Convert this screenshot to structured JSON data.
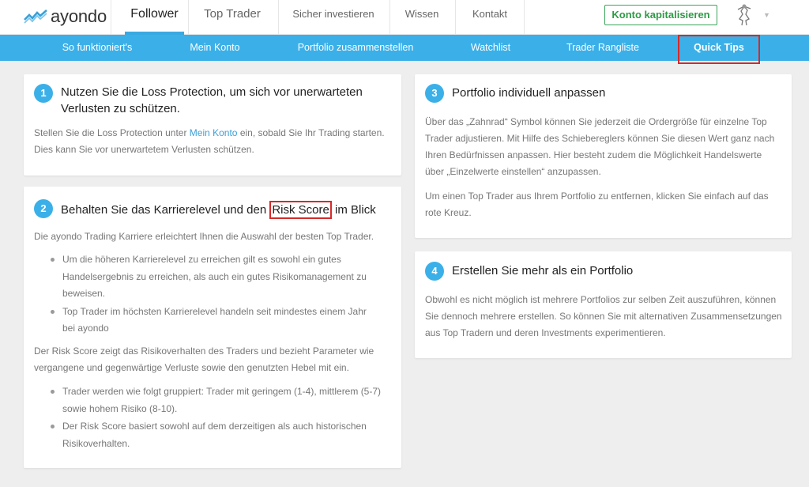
{
  "header": {
    "logo_text": "ayondo",
    "nav": [
      "Follower",
      "Top Trader",
      "Sicher investieren",
      "Wissen",
      "Kontakt"
    ],
    "cta_label": "Konto kapitalisieren"
  },
  "subnav": [
    "So funktioniert's",
    "Mein Konto",
    "Portfolio zusammenstellen",
    "Watchlist",
    "Trader Rangliste",
    "Quick Tips"
  ],
  "colors": {
    "accent": "#3bb0e8",
    "cta_green": "#2f9a47",
    "highlight_red": "#d42a2a"
  },
  "card1": {
    "num": "1",
    "title": "Nutzen Sie die Loss Protection, um sich vor unerwarteten Verlusten zu schützen.",
    "text_before": "Stellen Sie die Loss Protection unter ",
    "link": "Mein Konto",
    "text_after": " ein, sobald Sie Ihr Trading starten. Dies kann Sie vor unerwartetem Verlusten schützen."
  },
  "card2": {
    "num": "2",
    "title_before": "Behalten Sie das Karrierelevel und den ",
    "title_highlight": "Risk Score",
    "title_after": " im Blick",
    "intro": "Die ayondo Trading Karriere erleichtert Ihnen die Auswahl der besten Top Trader.",
    "bullets1": [
      "Um die höheren Karrierelevel zu erreichen gilt es sowohl ein gutes Handelsergebnis zu erreichen, als auch ein gutes Risikomanagement zu beweisen.",
      "Top Trader im höchsten Karrierelevel handeln seit mindestes einem Jahr bei ayondo"
    ],
    "middle": "Der Risk Score zeigt das Risikoverhalten des Traders und bezieht Parameter wie vergangene und gegenwärtige Verluste sowie den genutzten Hebel mit ein.",
    "bullets2": [
      "Trader werden wie folgt gruppiert: Trader mit geringem (1-4), mittlerem (5-7) sowie hohem Risiko (8-10).",
      "Der Risk Score basiert sowohl auf dem derzeitigen als auch historischen Risikoverhalten."
    ]
  },
  "card3": {
    "num": "3",
    "title": "Portfolio individuell anpassen",
    "p1": "Über das „Zahnrad“ Symbol können Sie jederzeit die Ordergröße für einzelne Top Trader adjustieren. Mit Hilfe des Schiebereglers können Sie diesen Wert ganz nach Ihren Bedürfnissen anpassen. Hier besteht zudem die Möglichkeit Handelswerte über „Einzelwerte einstellen“ anzupassen.",
    "p2": "Um einen Top Trader aus Ihrem Portfolio zu entfernen, klicken Sie einfach auf das rote Kreuz."
  },
  "card4": {
    "num": "4",
    "title": "Erstellen Sie mehr als ein Portfolio",
    "p1": "Obwohl es nicht möglich ist mehrere Portfolios zur selben Zeit auszuführen, können Sie dennoch mehrere erstellen. So können Sie mit alternativen Zusammensetzungen aus Top Tradern und deren Investments experimentieren."
  }
}
